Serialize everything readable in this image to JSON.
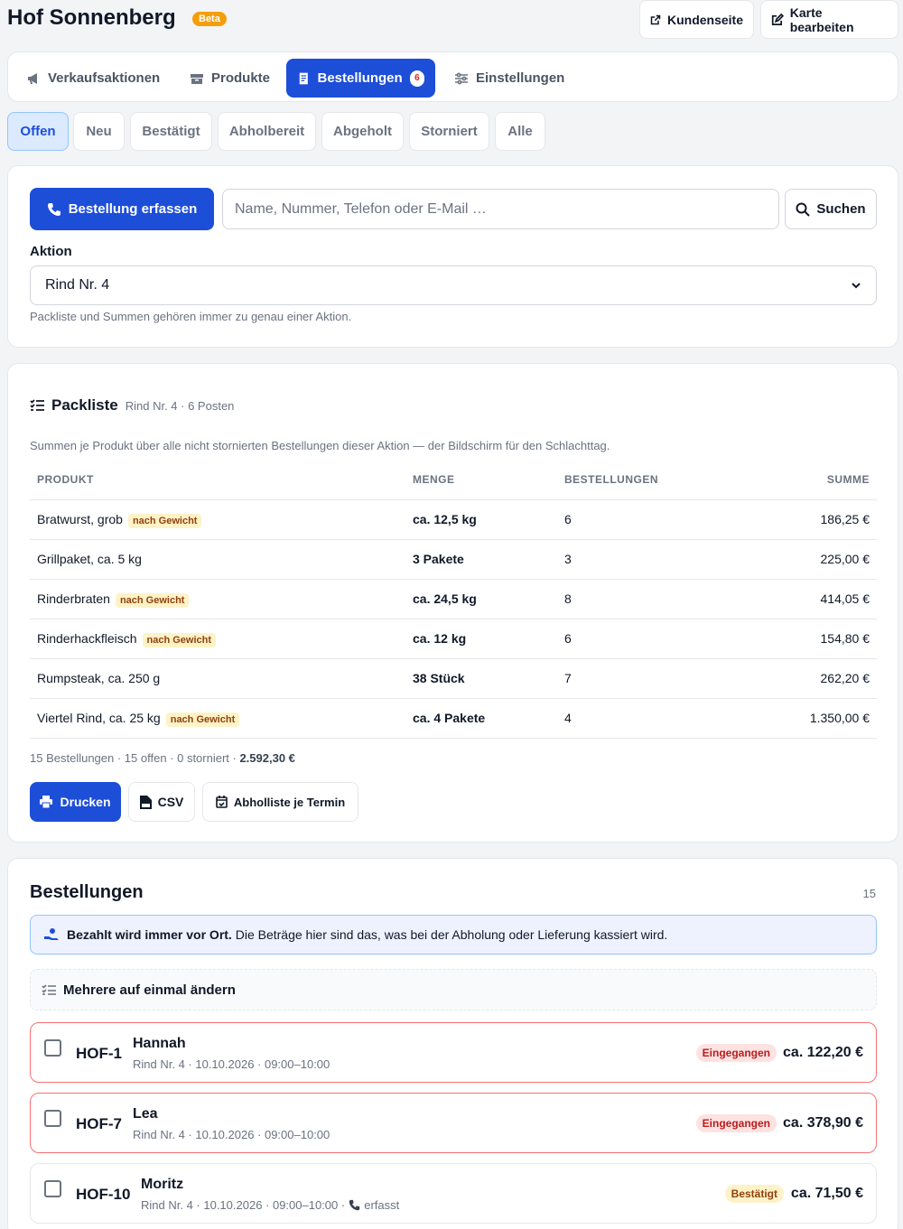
{
  "app": {
    "title": "Hof Sonnenberg",
    "badge": "Beta"
  },
  "header_buttons": {
    "customer_page": "Kundenseite",
    "edit_map": "Karte bearbeiten"
  },
  "nav": {
    "tabs": [
      {
        "label": "Verkaufsaktionen",
        "icon": "megaphone-icon"
      },
      {
        "label": "Produkte",
        "icon": "box-icon"
      },
      {
        "label": "Bestellungen",
        "icon": "receipt-icon",
        "badge": "6",
        "active": true
      },
      {
        "label": "Einstellungen",
        "icon": "sliders-icon"
      }
    ]
  },
  "filters": [
    "Offen",
    "Neu",
    "Bestätigt",
    "Abholbereit",
    "Abgeholt",
    "Storniert",
    "Alle"
  ],
  "filters_active": "Offen",
  "search": {
    "create_button": "Bestellung erfassen",
    "placeholder": "Name, Nummer, Telefon oder E-Mail …",
    "search_button": "Suchen",
    "action_label": "Aktion",
    "action_selected": "Rind Nr. 4",
    "help": "Packliste und Summen gehören immer zu genau einer Aktion."
  },
  "packliste": {
    "title": "Packliste",
    "subtitle": "Rind Nr. 4 · 6 Posten",
    "description": "Summen je Produkt über alle nicht stornierten Bestellungen dieser Aktion — der Bildschirm für den Schlachttag.",
    "headers": {
      "product": "PRODUKT",
      "qty": "MENGE",
      "orders": "BESTELLUNGEN",
      "sum": "SUMME"
    },
    "weight_tag": "nach Gewicht",
    "rows": [
      {
        "product": "Bratwurst, grob",
        "by_weight": true,
        "qty": "ca. 12,5 kg",
        "orders": "6",
        "sum": "186,25 €"
      },
      {
        "product": "Grillpaket, ca. 5 kg",
        "by_weight": false,
        "qty": "3 Pakete",
        "orders": "3",
        "sum": "225,00 €"
      },
      {
        "product": "Rinderbraten",
        "by_weight": true,
        "qty": "ca. 24,5 kg",
        "orders": "8",
        "sum": "414,05 €"
      },
      {
        "product": "Rinderhackfleisch",
        "by_weight": true,
        "qty": "ca. 12 kg",
        "orders": "6",
        "sum": "154,80 €"
      },
      {
        "product": "Rumpsteak, ca. 250 g",
        "by_weight": false,
        "qty": "38 Stück",
        "orders": "7",
        "sum": "262,20 €"
      },
      {
        "product": "Viertel Rind, ca. 25 kg",
        "by_weight": true,
        "qty": "ca. 4 Pakete",
        "orders": "4",
        "sum": "1.350,00 €"
      }
    ],
    "summary_prefix": "15 Bestellungen · 15 offen · 0 storniert · ",
    "summary_total": "2.592,30 €",
    "buttons": {
      "print": "Drucken",
      "csv": "CSV",
      "pickup_list": "Abholliste je Termin"
    }
  },
  "orders": {
    "title": "Bestellungen",
    "count": "15",
    "info_bold": "Bezahlt wird immer vor Ort.",
    "info_text": " Die Beträge hier sind das, was bei der Abholung oder Lieferung kassiert wird.",
    "bulk_label": "Mehrere auf einmal ändern",
    "items": [
      {
        "number": "HOF-1",
        "name": "Hannah",
        "meta": "Rind Nr. 4 · 10.10.2026 · 09:00–10:00",
        "extra": "",
        "status": "Eingegangen",
        "status_kind": "in",
        "amount": "ca. 122,20 €"
      },
      {
        "number": "HOF-7",
        "name": "Lea",
        "meta": "Rind Nr. 4 · 10.10.2026 · 09:00–10:00",
        "extra": "",
        "status": "Eingegangen",
        "status_kind": "in",
        "amount": "ca. 378,90 €"
      },
      {
        "number": "HOF-10",
        "name": "Moritz",
        "meta": "Rind Nr. 4 · 10.10.2026 · 09:00–10:00 ·",
        "extra": "erfasst",
        "status": "Bestätigt",
        "status_kind": "ok",
        "amount": "ca. 71,50 €"
      }
    ]
  },
  "colors": {
    "primary": "#1d4ed8",
    "danger": "#b91c1c",
    "warning_bg": "#fef3c7",
    "brand_badge": "#f59e0b"
  }
}
